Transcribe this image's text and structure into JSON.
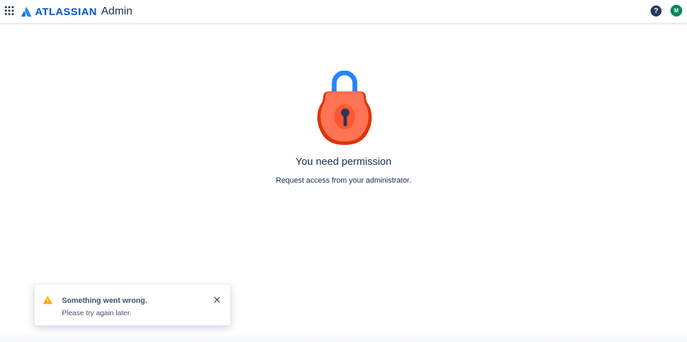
{
  "header": {
    "brand": "ATLASSIAN",
    "product": "Admin",
    "help_icon": "question-circle-icon",
    "help_glyph": "?",
    "avatar_initial": "M",
    "avatar_color": "#00875A",
    "app_switcher_icon": "app-switcher-grid-icon"
  },
  "main": {
    "illustration": "padlock-icon",
    "title": "You need permission",
    "description": "Request access from your administrator."
  },
  "flag": {
    "icon": "warning-icon",
    "title": "Something went wrong.",
    "description": "Please try again later.",
    "close_icon": "close-icon"
  },
  "colors": {
    "brand_blue": "#0052CC",
    "text": "#172B4D",
    "warning": "#FFAB00",
    "lock_body": "#FF5630"
  }
}
